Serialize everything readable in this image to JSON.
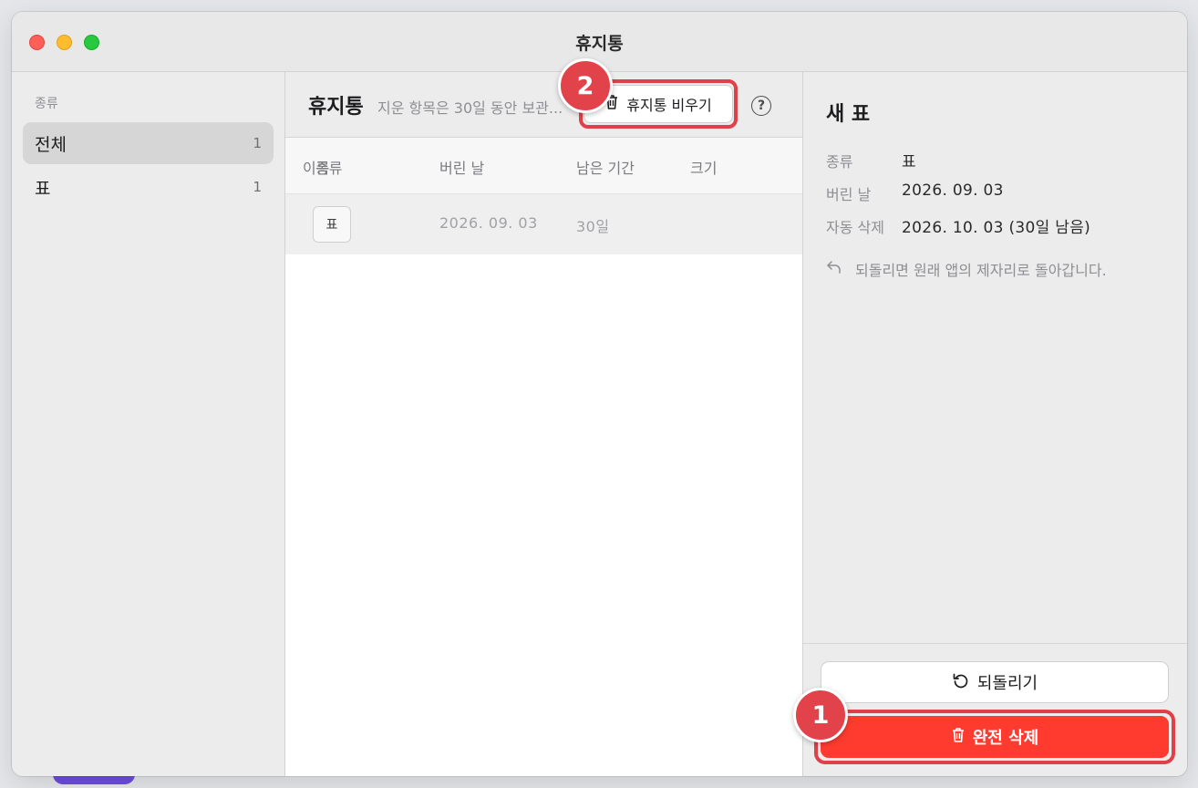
{
  "window": {
    "title": "휴지통"
  },
  "sidebar": {
    "heading": "종류",
    "items": [
      {
        "label": "전체",
        "count": "1",
        "active": true
      },
      {
        "label": "표",
        "count": "1",
        "active": false
      }
    ]
  },
  "list": {
    "title": "휴지통",
    "subtitle": "지운 항목은 30일 동안 보관...",
    "empty_label": "휴지통 비우기",
    "help_label": "?",
    "columns": {
      "name": "이름",
      "type": "종류",
      "deleted": "버린 날",
      "remaining": "남은 기간",
      "size": "크기"
    },
    "rows": [
      {
        "type": "표",
        "deleted": "2026. 09. 03",
        "remaining": "30일",
        "size": ""
      }
    ]
  },
  "detail": {
    "title": "새 표",
    "fields": [
      {
        "key": "종류",
        "value": "표"
      },
      {
        "key": "버린 날",
        "value": "2026. 09. 03"
      },
      {
        "key": "자동 삭제",
        "value": "2026. 10. 03 (30일 남음)"
      }
    ],
    "note": "되돌리면 원래 앱의 제자리로 돌아갑니다.",
    "restore_label": "되돌리기",
    "delete_label": "완전 삭제"
  },
  "callouts": {
    "one": "1",
    "two": "2"
  },
  "colors": {
    "danger": "#ff3b30",
    "highlight": "#e04048"
  }
}
